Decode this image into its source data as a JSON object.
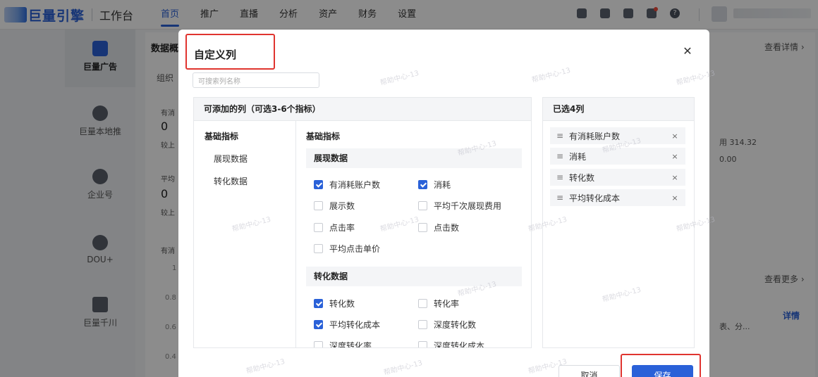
{
  "brand": {
    "logo_text": "巨量引擎",
    "workspace": "工作台"
  },
  "nav": [
    "首页",
    "推广",
    "直播",
    "分析",
    "资产",
    "财务",
    "设置"
  ],
  "nav_active": "首页",
  "top_icons": [
    "phone-icon",
    "clipboard-icon",
    "thumbs-up-icon",
    "bell-icon",
    "help-icon"
  ],
  "sidebar": [
    {
      "label": "巨量广告",
      "icon": "ocean-ad-icon"
    },
    {
      "label": "巨量本地推",
      "icon": "location-icon"
    },
    {
      "label": "企业号",
      "icon": "enterprise-icon"
    },
    {
      "label": "DOU+",
      "icon": "dou-plus-icon"
    },
    {
      "label": "巨量千川",
      "icon": "qianchuan-icon"
    }
  ],
  "background": {
    "section_title": "数据概",
    "org_label": "组织",
    "metric1_label": "有消",
    "metric1_value": "0",
    "metric1_sub": "较上",
    "metric2_label": "平均",
    "metric2_value": "0",
    "metric2_sub": "较上",
    "chart_label": "有消",
    "y_ticks": [
      "1",
      "0.8",
      "0.6",
      "0.4"
    ],
    "right_value1": "用 314.32",
    "right_value2": "0.00",
    "link_details": "查看详情 ›",
    "link_more": "查看更多 ›",
    "details_btn": "详情",
    "desc_text": "表、分..."
  },
  "modal": {
    "title": "自定义列",
    "search_placeholder": "可搜索列名称",
    "left_panel_title": "可添加的列（可选3-6个指标）",
    "categories_header": "基础指标",
    "categories": [
      "展现数据",
      "转化数据"
    ],
    "metrics_header": "基础指标",
    "groups": [
      {
        "name": "展现数据",
        "items": [
          {
            "label": "有消耗账户数",
            "checked": true
          },
          {
            "label": "消耗",
            "checked": true
          },
          {
            "label": "展示数",
            "checked": false
          },
          {
            "label": "平均千次展现费用",
            "checked": false
          },
          {
            "label": "点击率",
            "checked": false
          },
          {
            "label": "点击数",
            "checked": false
          },
          {
            "label": "平均点击单价",
            "checked": false
          }
        ]
      },
      {
        "name": "转化数据",
        "items": [
          {
            "label": "转化数",
            "checked": true
          },
          {
            "label": "转化率",
            "checked": false
          },
          {
            "label": "平均转化成本",
            "checked": true
          },
          {
            "label": "深度转化数",
            "checked": false
          },
          {
            "label": "深度转化率",
            "checked": false
          },
          {
            "label": "深度转化成本",
            "checked": false
          }
        ]
      }
    ],
    "right_panel_title": "已选4列",
    "selected": [
      "有消耗账户数",
      "消耗",
      "转化数",
      "平均转化成本"
    ],
    "cancel_label": "取消",
    "save_label": "保存",
    "watermark": "帮助中心-13"
  },
  "colors": {
    "primary": "#2a61d8",
    "highlight": "#e0342f"
  }
}
